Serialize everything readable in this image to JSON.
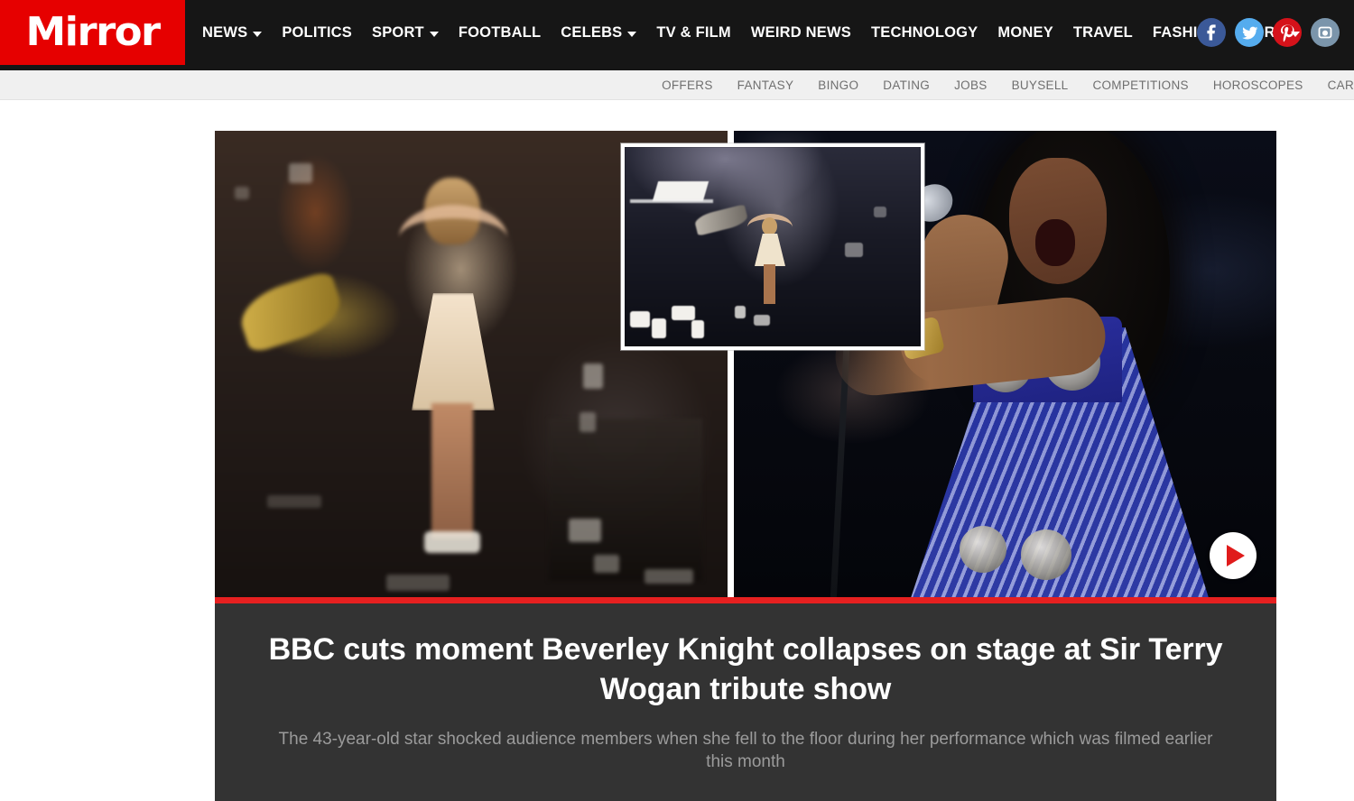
{
  "site": {
    "logo_text": "Mirror",
    "logo_bg": "#e60000",
    "header_bg": "#161616"
  },
  "main_nav": [
    {
      "label": "NEWS",
      "has_caret": true
    },
    {
      "label": "POLITICS",
      "has_caret": false
    },
    {
      "label": "SPORT",
      "has_caret": true
    },
    {
      "label": "FOOTBALL",
      "has_caret": false
    },
    {
      "label": "CELEBS",
      "has_caret": true
    },
    {
      "label": "TV & FILM",
      "has_caret": false
    },
    {
      "label": "WEIRD NEWS",
      "has_caret": false
    },
    {
      "label": "TECHNOLOGY",
      "has_caret": false
    },
    {
      "label": "MONEY",
      "has_caret": false
    },
    {
      "label": "TRAVEL",
      "has_caret": false
    },
    {
      "label": "FASHION",
      "has_caret": false
    },
    {
      "label": "MORE",
      "has_caret": true
    }
  ],
  "social": [
    {
      "name": "facebook-icon",
      "glyph": "f",
      "color": "#3b5998"
    },
    {
      "name": "twitter-icon",
      "glyph": "t",
      "color": "#55acee"
    },
    {
      "name": "pinterest-icon",
      "glyph": "P",
      "color": "#d5121a"
    },
    {
      "name": "instagram-icon",
      "glyph": "i",
      "color": "#7b95ab"
    }
  ],
  "sub_nav": [
    {
      "label": "OFFERS"
    },
    {
      "label": "FANTASY"
    },
    {
      "label": "BINGO"
    },
    {
      "label": "DATING"
    },
    {
      "label": "JOBS"
    },
    {
      "label": "BUYSELL"
    },
    {
      "label": "COMPETITIONS"
    },
    {
      "label": "HOROSCOPES"
    },
    {
      "label": "CAR"
    }
  ],
  "article": {
    "headline": "BBC cuts moment Beverley Knight collapses on stage at Sir Terry Wogan tribute show",
    "standfirst": "The 43-year-old star shocked audience members when she fell to the floor during her performance which was filmed earlier this month",
    "accent_color": "#e62020",
    "caption_bg": "#333333",
    "play_button_label": "Play video"
  }
}
